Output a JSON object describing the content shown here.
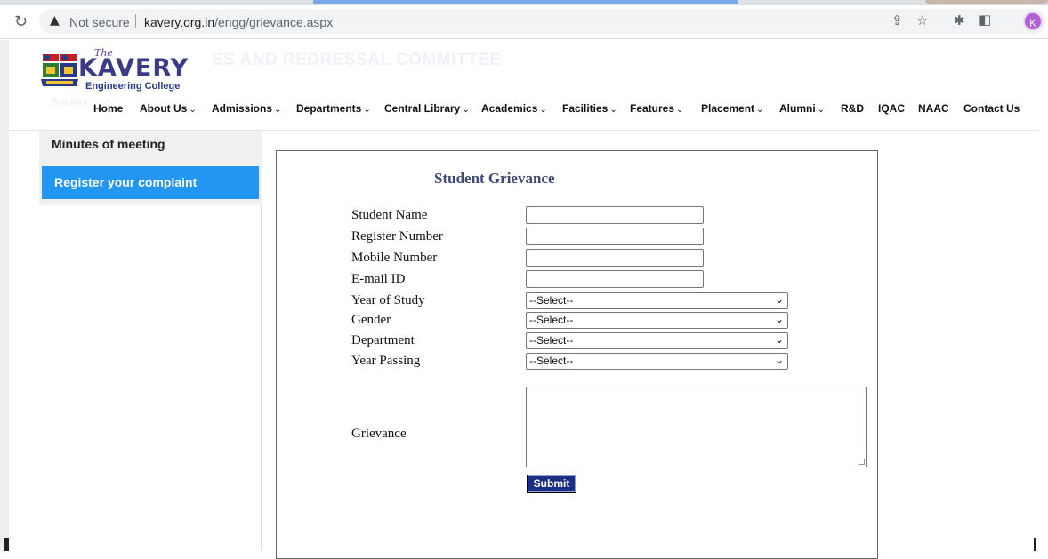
{
  "browser": {
    "security_label": "Not secure",
    "url_host": "kavery.org.in",
    "url_path": "/engg/grievance.aspx",
    "profile_initial": "K"
  },
  "header": {
    "logo_the": "The",
    "logo_name": "KAVERY",
    "logo_sub": "Engineering College",
    "ghost_title": "ES AND REDRESSAL COMMITTEE",
    "ghost_sub": "Student"
  },
  "nav": {
    "items": [
      {
        "label": "Home",
        "chevron": ""
      },
      {
        "label": "About Us",
        "chevron": "⌄"
      },
      {
        "label": "Admissions",
        "chevron": "⌄"
      },
      {
        "label": "Departments",
        "chevron": "⌄"
      },
      {
        "label": "Central Library",
        "chevron": "⌄"
      },
      {
        "label": "Academics",
        "chevron": "⌄"
      },
      {
        "label": "Facilities",
        "chevron": "⌄"
      },
      {
        "label": "Features",
        "chevron": "⌄"
      },
      {
        "label": "Placement",
        "chevron": "⌄"
      },
      {
        "label": "Alumni",
        "chevron": "⌄"
      },
      {
        "label": "R&D",
        "chevron": ""
      },
      {
        "label": "IQAC",
        "chevron": ""
      },
      {
        "label": "NAAC",
        "chevron": ""
      },
      {
        "label": "Contact Us",
        "chevron": ""
      }
    ]
  },
  "sidebar": {
    "items": [
      {
        "label": "Minutes of meeting"
      },
      {
        "label": "Register your complaint"
      }
    ]
  },
  "form": {
    "title": "Student Grievance",
    "fields": [
      {
        "label": "Student Name",
        "value": ""
      },
      {
        "label": "Register Number",
        "value": ""
      },
      {
        "label": "Mobile Number",
        "value": ""
      },
      {
        "label": "E-mail ID",
        "value": ""
      }
    ],
    "selects": [
      {
        "label": "Year of Study",
        "value": "--Select--"
      },
      {
        "label": "Gender",
        "value": "--Select--"
      },
      {
        "label": "Department",
        "value": "--Select--"
      },
      {
        "label": "Year Passing",
        "value": "--Select--"
      }
    ],
    "grievance_label": "Grievance",
    "grievance_value": "",
    "submit_label": "Submit"
  }
}
